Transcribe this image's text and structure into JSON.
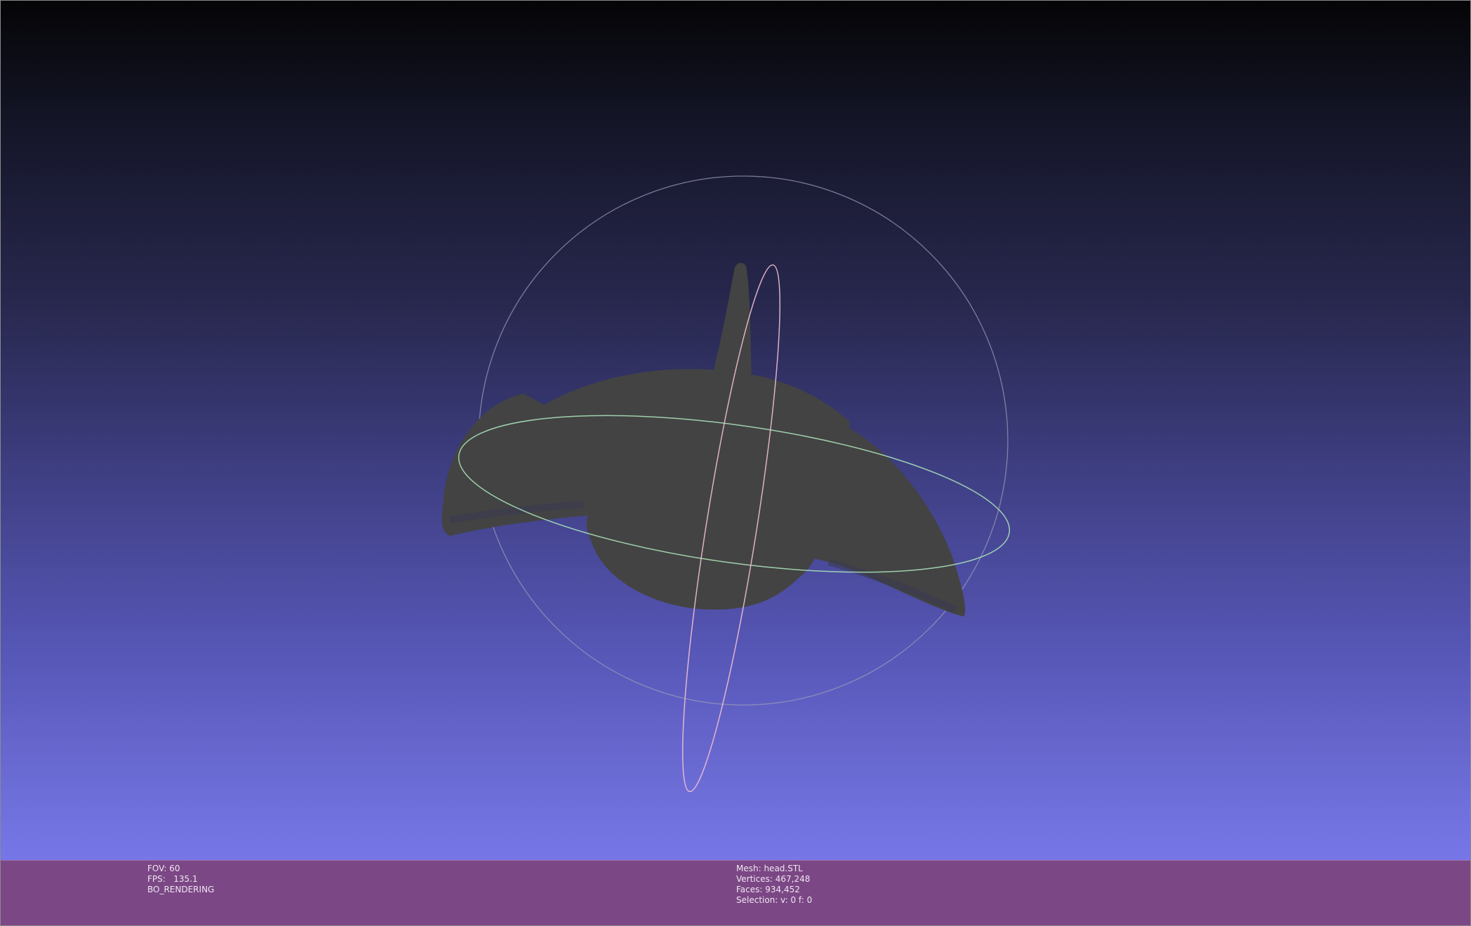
{
  "info_left": {
    "fov": "FOV: 60",
    "fps": "FPS:   135.1",
    "mode": "BO_RENDERING"
  },
  "info_right": {
    "mesh": "Mesh: head.STL",
    "vertices": "Vertices: 467,248",
    "faces": "Faces: 934,452",
    "selection": "Selection: v: 0 f: 0"
  },
  "colors": {
    "mesh": "#434343",
    "trackball_equator": "#a8e0b8",
    "trackball_meridian": "#f0c0d0",
    "trackball_outline": "#9a9ab8",
    "info_bar": "#7b4785"
  },
  "icons": {
    "trackball": "trackball-gizmo",
    "mesh": "stl-mesh-render"
  }
}
